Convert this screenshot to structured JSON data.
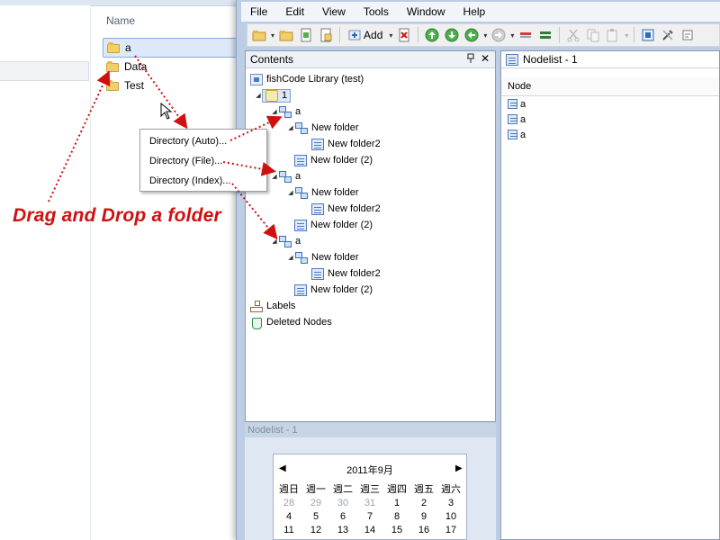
{
  "explorer": {
    "column_header": "Name",
    "items": [
      {
        "name": "a",
        "selected": true
      },
      {
        "name": "Data",
        "selected": false
      },
      {
        "name": "Test",
        "selected": false
      }
    ]
  },
  "app": {
    "menu": [
      "File",
      "Edit",
      "View",
      "Tools",
      "Window",
      "Help"
    ],
    "toolbar": {
      "add_label": "Add"
    },
    "contents_panel": {
      "title": "Contents",
      "pin_icon": "pin-icon",
      "close_glyph": "✕",
      "root_label": "fishCode Library (test)",
      "tree": [
        {
          "label": "1"
        },
        {
          "label": "a"
        },
        {
          "label": "New folder"
        },
        {
          "label": "New folder2"
        },
        {
          "label": "New folder (2)"
        },
        {
          "label": "a"
        },
        {
          "label": "New folder"
        },
        {
          "label": "New folder2"
        },
        {
          "label": "New folder (2)"
        },
        {
          "label": "a"
        },
        {
          "label": "New folder"
        },
        {
          "label": "New folder2"
        },
        {
          "label": "New folder (2)"
        }
      ],
      "labels_label": "Labels",
      "deleted_label": "Deleted Nodes"
    },
    "nodelist_panel": {
      "title": "Nodelist - 1",
      "column_header": "Node",
      "rows": [
        "a",
        "a",
        "a"
      ]
    },
    "nodelist_strip": "Nodelist - 1",
    "calendar": {
      "title": "2011年9月",
      "prev_glyph": "◀",
      "next_glyph": "▶",
      "weekdays": [
        "週日",
        "週一",
        "週二",
        "週三",
        "週四",
        "週五",
        "週六"
      ],
      "weeks": [
        [
          "28",
          "29",
          "30",
          "31",
          "1",
          "2",
          "3"
        ],
        [
          "4",
          "5",
          "6",
          "7",
          "8",
          "9",
          "10"
        ],
        [
          "11",
          "12",
          "13",
          "14",
          "15",
          "16",
          "17"
        ]
      ]
    }
  },
  "context_menu": {
    "items": [
      "Directory (Auto)...",
      "Directory (File)...",
      "Directory (Index)..."
    ]
  },
  "annotation": {
    "text": "Drag and Drop a folder",
    "color": "#d01010"
  }
}
